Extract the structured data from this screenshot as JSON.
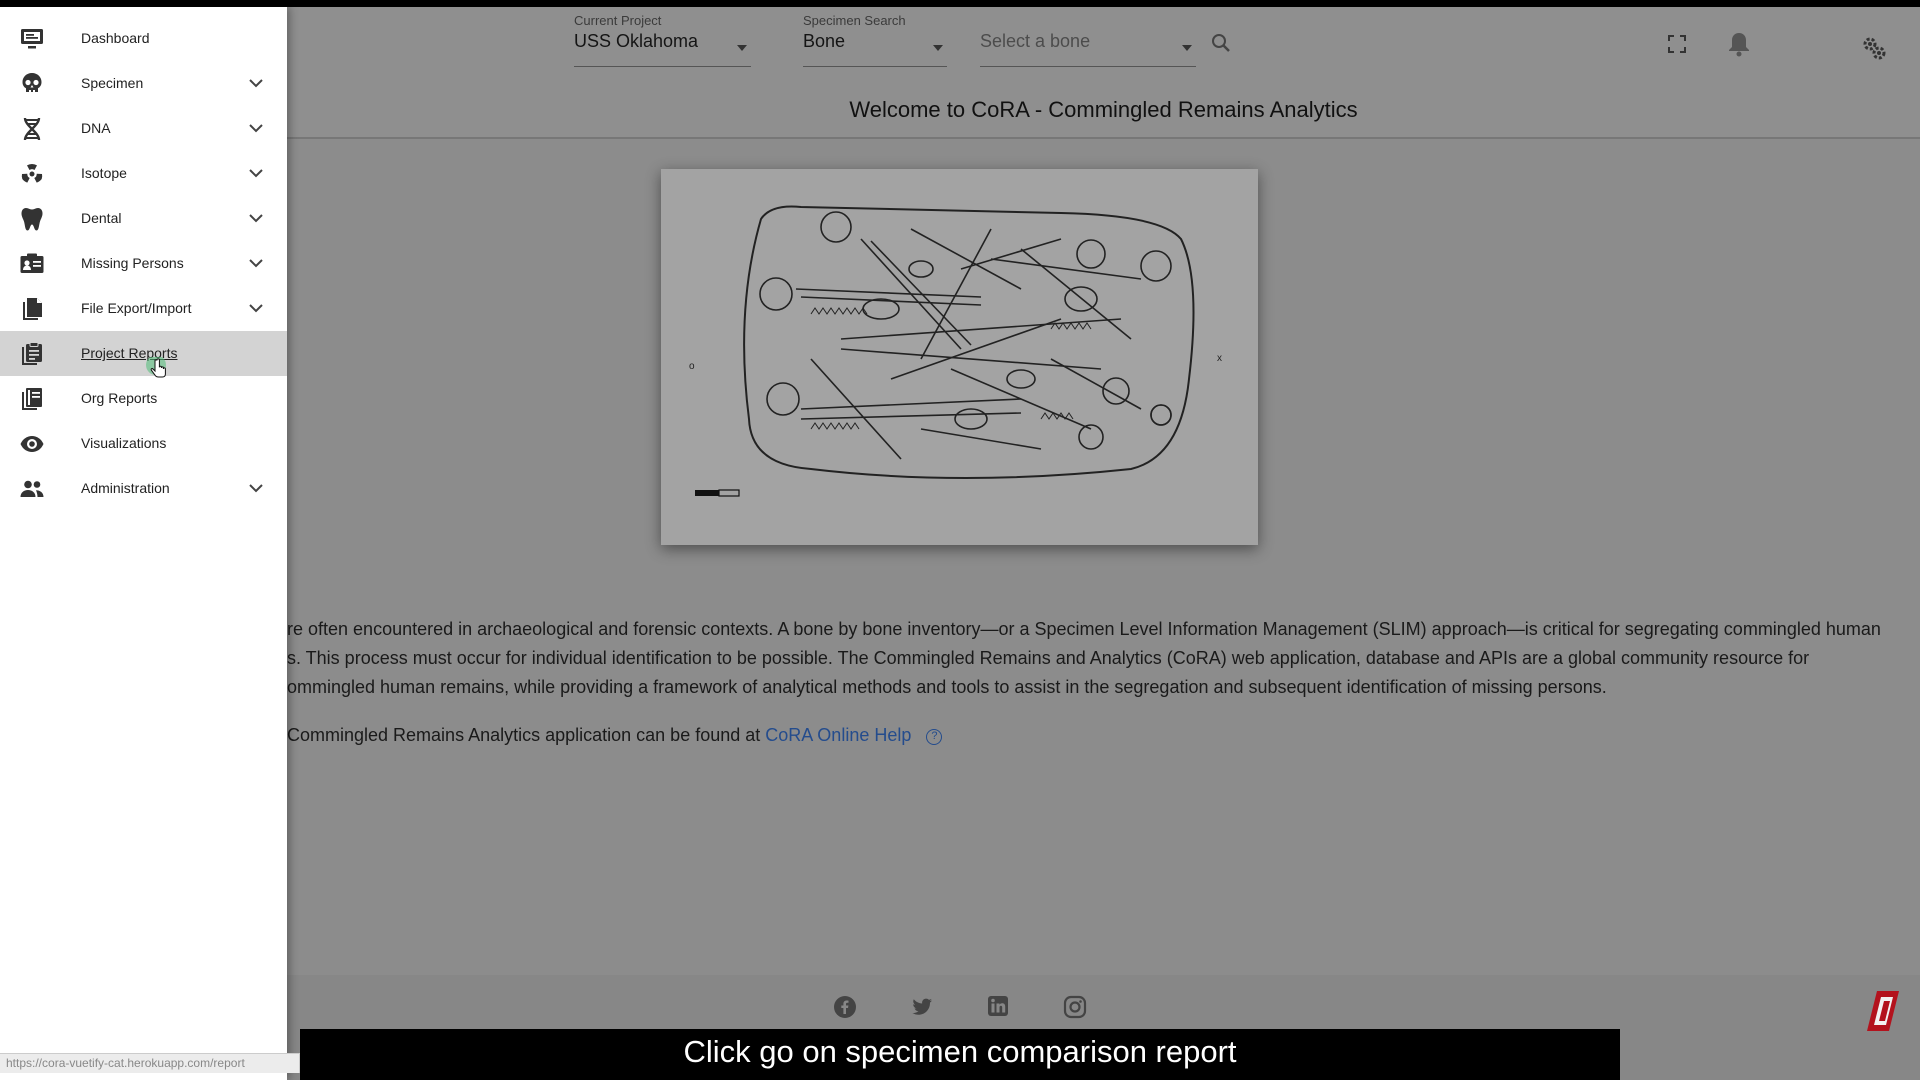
{
  "header": {
    "current_project_label": "Current Project",
    "current_project_value": "USS Oklahoma",
    "specimen_search_label": "Specimen Search",
    "specimen_search_value": "Bone",
    "bone_select_placeholder": "Select a bone",
    "notification_count": "0"
  },
  "page": {
    "title": "Welcome to CoRA - Commingled Remains Analytics",
    "intro_lines": [
      "re often encountered in archaeological and forensic contexts. A bone by bone inventory—or a Specimen Level Information Management (SLIM) approach—is critical for segregating commingled human",
      "s. This process must occur for individual identification to be possible. The Commingled Remains and Analytics (CoRA) web application, database and APIs are a global community resource for",
      "ommingled human remains, while providing a framework of analytical methods and tools to assist in the segregation and subsequent identification of missing persons."
    ],
    "help_prefix": "Commingled Remains Analytics application can be found at",
    "help_link": "CoRA Online Help",
    "help_icon_glyph": "?"
  },
  "sidebar": {
    "items": [
      {
        "label": "Dashboard",
        "icon": "monitor-icon"
      },
      {
        "label": "Specimen",
        "icon": "skull-icon"
      },
      {
        "label": "DNA",
        "icon": "dna-icon"
      },
      {
        "label": "Isotope",
        "icon": "radiation-icon"
      },
      {
        "label": "Dental",
        "icon": "tooth-icon"
      },
      {
        "label": "Missing Persons",
        "icon": "id-card-icon"
      },
      {
        "label": "File Export/Import",
        "icon": "file-copy-icon"
      },
      {
        "label": "Project Reports",
        "icon": "clipboard-icon",
        "active": true
      },
      {
        "label": "Org Reports",
        "icon": "books-icon"
      },
      {
        "label": "Visualizations",
        "icon": "eye-icon"
      },
      {
        "label": "Administration",
        "icon": "people-icon"
      }
    ]
  },
  "status_url": "https://cora-vuetify-cat.herokuapp.com/report",
  "caption": "Click go on specimen comparison report",
  "colors": {
    "link": "#244c8d",
    "badge": "#1e55a3",
    "active_nav": "#d3d3d3"
  }
}
